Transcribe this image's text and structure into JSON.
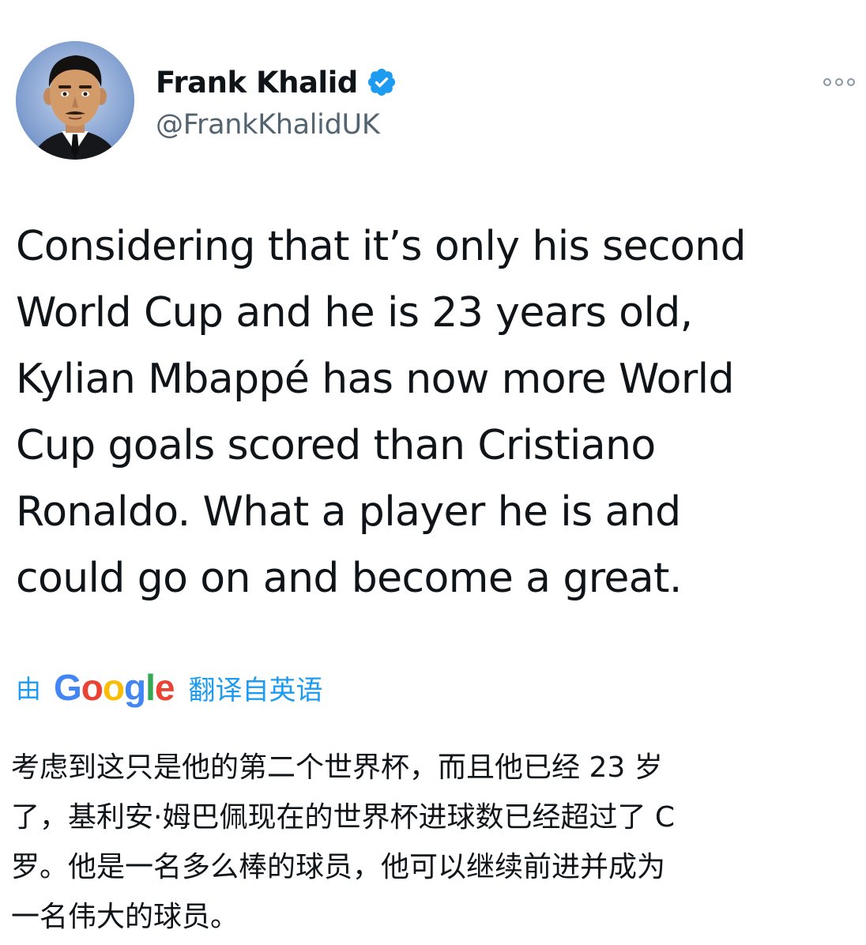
{
  "author": {
    "display_name": "Frank Khalid",
    "handle": "@FrankKhalidUK",
    "verified": true,
    "avatar_icon": "cartoon-man-avatar-icon"
  },
  "menu": {
    "icon": "more-options-icon"
  },
  "tweet": {
    "lines": [
      "Considering that it’s only his second",
      "World Cup and he is 23 years old,",
      "Kylian Mbappé has now more World",
      "Cup goals scored than Cristiano",
      "Ronaldo. What a player he is and",
      "could go on and become a great."
    ]
  },
  "translation": {
    "by_label": "由",
    "provider_letters": [
      "G",
      "o",
      "o",
      "g",
      "l",
      "e"
    ],
    "provider_colors": [
      "#4285f4",
      "#ea4335",
      "#fbbc05",
      "#4285f4",
      "#34a853",
      "#ea4335"
    ],
    "from_label": "翻译自英语",
    "lines": [
      "考虑到这只是他的第二个世界杯，而且他已经 23 岁",
      "了，基利安·姆巴佩现在的世界杯进球数已经超过了 C",
      "罗。他是一名多么棒的球员，他可以继续前进并成为",
      "一名伟大的球员。"
    ]
  },
  "colors": {
    "text": "#0f1419",
    "secondary": "#536471",
    "accent": "#1d9bf0",
    "background": "#ffffff"
  }
}
